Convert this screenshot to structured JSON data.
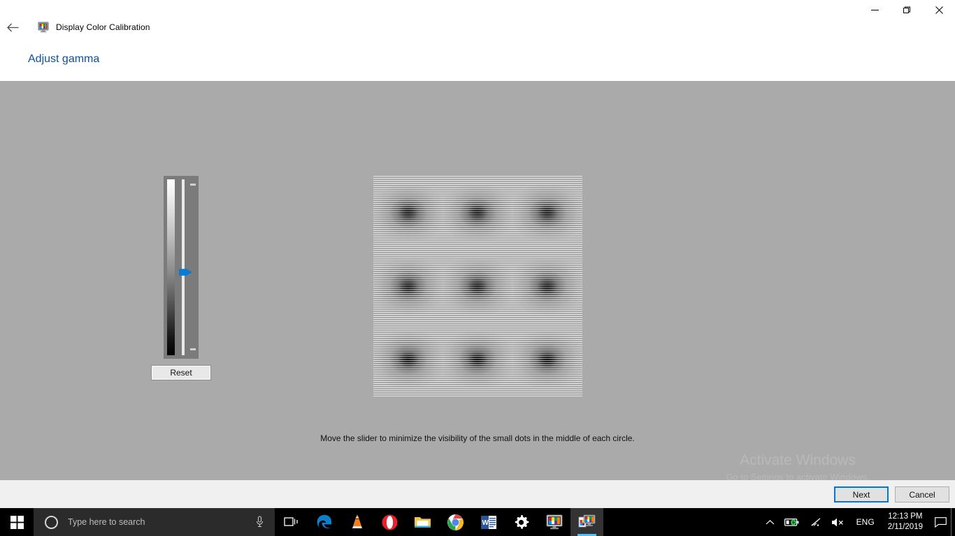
{
  "window": {
    "app_title": "Display Color Calibration",
    "app_icon": "monitor-color-icon",
    "back_icon": "back-arrow-icon",
    "controls": {
      "minimize": "minimize-icon",
      "maximize": "maximize-icon",
      "close": "close-icon"
    }
  },
  "page": {
    "heading": "Adjust gamma",
    "caption": "Move the slider to minimize the visibility of the small dots in the middle of each circle."
  },
  "slider": {
    "name": "gamma-slider",
    "orientation": "vertical",
    "thumb_position_percent": 53,
    "reset_label": "Reset",
    "tick_top": "max-tick",
    "tick_bottom": "min-tick"
  },
  "pattern": {
    "name": "gamma-test-pattern",
    "rows": 3,
    "columns": 3,
    "description": "3x3 grid of scanline circles with dark dots in the middle"
  },
  "watermark": {
    "title": "Activate Windows",
    "subtitle": "Go to Settings to activate Windows."
  },
  "footer": {
    "next_label": "Next",
    "cancel_label": "Cancel"
  },
  "taskbar": {
    "start_icon": "windows-start-icon",
    "search": {
      "placeholder": "Type here to search",
      "cortana_icon": "cortana-circle-icon",
      "mic_icon": "microphone-icon"
    },
    "items": [
      {
        "name": "task-view-icon",
        "label": "Task View"
      },
      {
        "name": "microsoft-edge-icon",
        "label": "Microsoft Edge"
      },
      {
        "name": "vlc-media-player-icon",
        "label": "VLC media player"
      },
      {
        "name": "opera-browser-icon",
        "label": "Opera"
      },
      {
        "name": "file-explorer-icon",
        "label": "File Explorer"
      },
      {
        "name": "google-chrome-icon",
        "label": "Google Chrome"
      },
      {
        "name": "microsoft-word-icon",
        "label": "Microsoft Word"
      },
      {
        "name": "settings-gear-icon",
        "label": "Settings"
      },
      {
        "name": "display-color-calibration-icon",
        "label": "Display Color Calibration"
      },
      {
        "name": "display-color-calibration-active-icon",
        "label": "Display Color Calibration"
      }
    ],
    "tray": {
      "overflow_icon": "chevron-up-icon",
      "battery_icon": "battery-icon",
      "network_icon": "wifi-icon",
      "volume_icon": "volume-muted-icon",
      "language": "ENG",
      "time": "12:13 PM",
      "date": "2/11/2019",
      "action_center_icon": "action-center-icon"
    }
  },
  "colors": {
    "accent": "#0078d7",
    "heading": "#0b4f9e",
    "workarea_bg": "#aaaaaa",
    "panel_bg": "#7b7b7b",
    "thumb": "#0a7bd4",
    "footer_bg": "#f0f0f0",
    "taskbar_bg": "#000000"
  }
}
